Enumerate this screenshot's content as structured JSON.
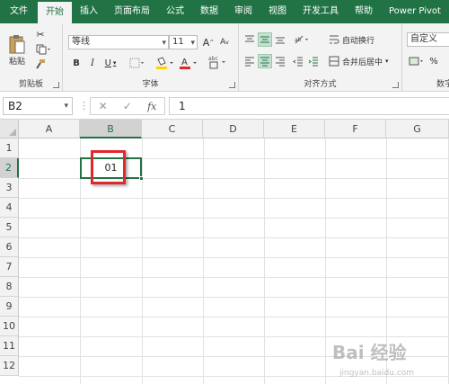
{
  "ribbon_tabs": [
    {
      "label": "文件"
    },
    {
      "label": "开始"
    },
    {
      "label": "插入"
    },
    {
      "label": "页面布局"
    },
    {
      "label": "公式"
    },
    {
      "label": "数据"
    },
    {
      "label": "审阅"
    },
    {
      "label": "视图"
    },
    {
      "label": "开发工具"
    },
    {
      "label": "帮助"
    },
    {
      "label": "Power Pivot"
    }
  ],
  "active_tab": "开始",
  "clipboard": {
    "paste_label": "粘贴",
    "group_label": "剪贴板"
  },
  "font": {
    "name": "等线",
    "size": "11",
    "grow": "A",
    "shrink": "A",
    "bold": "B",
    "italic": "I",
    "underline": "U",
    "group_label": "字体"
  },
  "alignment": {
    "wrap_text": "自动换行",
    "merge_center": "合并后居中",
    "group_label": "对齐方式"
  },
  "number": {
    "format": "自定义",
    "percent": "%",
    "group_label_partial": "数字"
  },
  "formula_bar": {
    "name_box": "B2",
    "fx": "fx",
    "cancel": "✕",
    "enter": "✓",
    "content": "1"
  },
  "columns": [
    "A",
    "B",
    "C",
    "D",
    "E",
    "F",
    "G"
  ],
  "rows": [
    "1",
    "2",
    "3",
    "4",
    "5",
    "6",
    "7",
    "8",
    "9",
    "10",
    "11",
    "12"
  ],
  "active_cell": {
    "ref": "B2",
    "display_value": "01"
  },
  "colors": {
    "accent": "#217346",
    "highlight": "#e0292c",
    "font_color_swatch": "#e0292c",
    "fill_swatch": "#ffd200"
  },
  "watermark": {
    "line1": "Bai 经验",
    "line2": "jingyan.baidu.com"
  }
}
